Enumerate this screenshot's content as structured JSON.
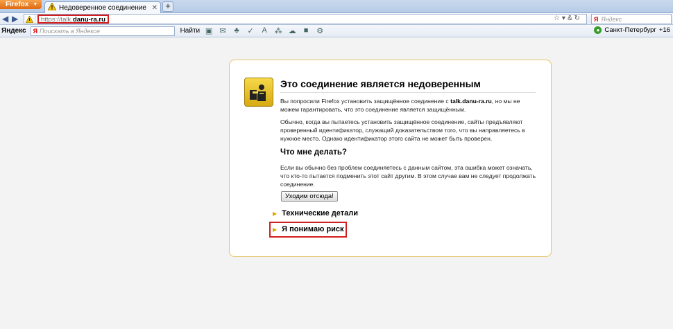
{
  "browser": {
    "menu_button": "Firefox",
    "tab": {
      "title": "Недоверенное соединение"
    },
    "new_tab": "+",
    "url": {
      "prefix": "https://talk.",
      "domain": "danu-ra.ru"
    },
    "search_placeholder": "Яндекс"
  },
  "yandex_bar": {
    "logo_text": "Яндекс",
    "search_placeholder": "Поискать в Яндексе",
    "find_button": "Найти",
    "city": "Санкт-Петербург",
    "temperature": "+16"
  },
  "error_page": {
    "title": "Это соединение является недоверенным",
    "intro_part1": "Вы попросили Firefox установить защищённое соединение с ",
    "intro_host": "talk.danu-ra.ru",
    "intro_part2": ", но мы не можем гарантировать, что это соединение является защищённым.",
    "explanation": "Обычно, когда вы пытаетесь установить защищённое соединение, сайты предъявляют проверенный идентификатор, служащий доказательством того, что вы направляетесь в нужное место. Однако идентификатор этого сайта не может быть проверен.",
    "what_to_do_heading": "Что мне делать?",
    "what_to_do_text": "Если вы обычно без проблем соединяетесь с данным сайтом, эта ошибка может означать, что кто-то пытается подменить этот сайт другим. В этом случае вам не следует продолжать соединение.",
    "get_me_out_button": "Уходим отсюда!",
    "technical_details": "Технические детали",
    "understand_risks": "Я понимаю риск"
  },
  "colors": {
    "highlight": "#d41d1d",
    "box_border": "#e6c46b",
    "accent_arrow": "#e3a000"
  }
}
